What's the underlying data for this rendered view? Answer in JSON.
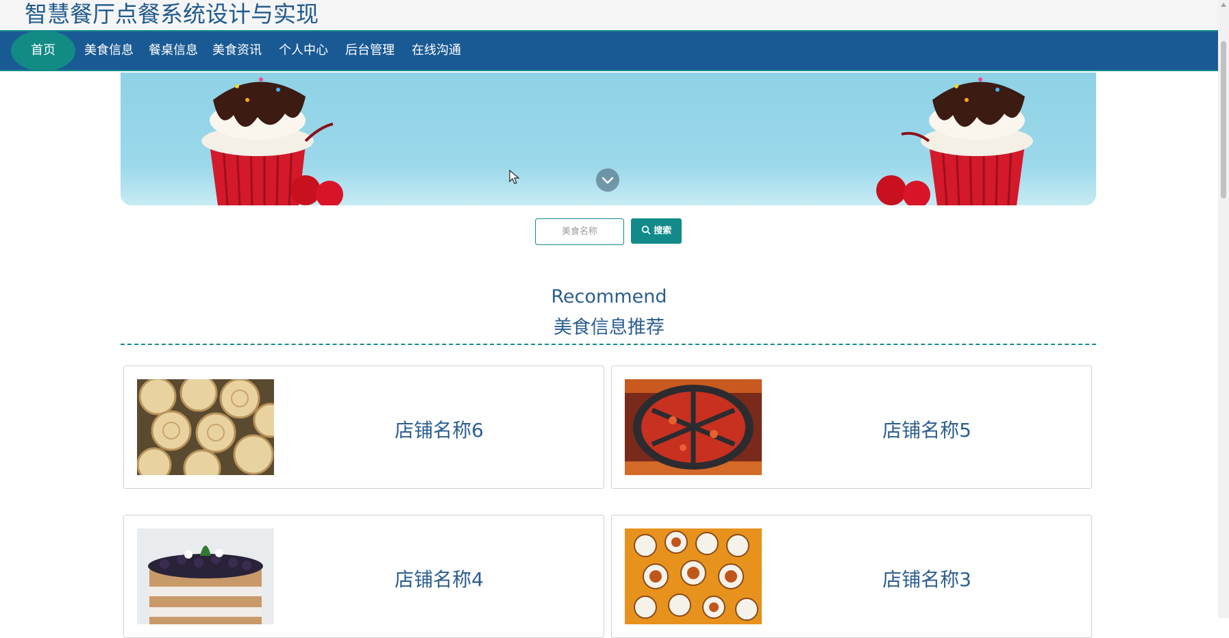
{
  "site": {
    "title": "智慧餐厅点餐系统设计与实现"
  },
  "nav": {
    "items": [
      "首页",
      "美食信息",
      "餐桌信息",
      "美食资讯",
      "个人中心",
      "后台管理",
      "在线沟通"
    ]
  },
  "search": {
    "placeholder": "美食名称",
    "button_label": "搜索"
  },
  "section": {
    "title_en": "Recommend",
    "title_cn": "美食信息推荐"
  },
  "cards": [
    {
      "name": "店铺名称6",
      "image": "pastry-image"
    },
    {
      "name": "店铺名称5",
      "image": "hotpot-image"
    },
    {
      "name": "店铺名称4",
      "image": "cake-image"
    },
    {
      "name": "店铺名称3",
      "image": "dishes-image"
    }
  ],
  "colors": {
    "nav_bg": "#1a5a94",
    "accent": "#128a8a",
    "text_blue": "#2a5d90"
  }
}
